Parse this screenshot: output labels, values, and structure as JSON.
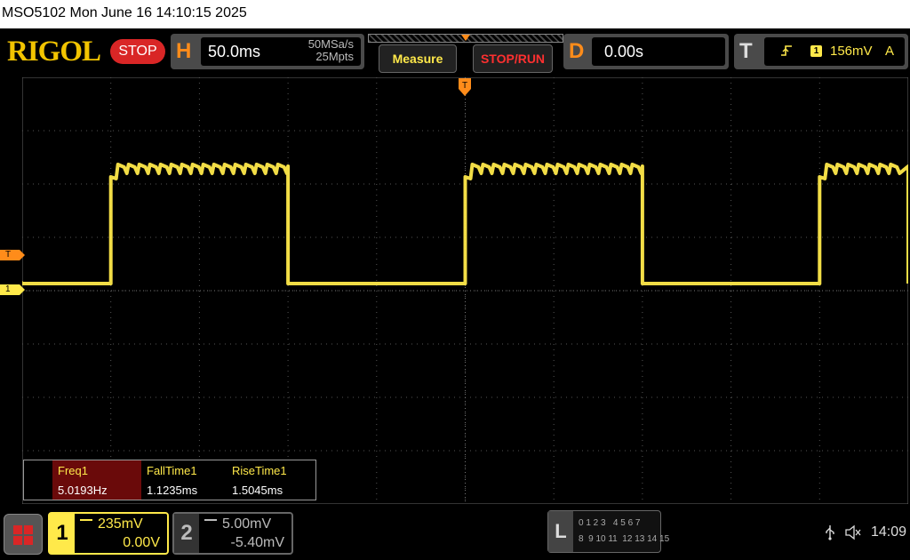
{
  "title_bar": {
    "text": "MSO5102  Mon June 16 14:10:15 2025"
  },
  "header": {
    "logo": "RIGOL",
    "run_state": "STOP",
    "horizontal": {
      "letter": "H",
      "timebase": "50.0ms",
      "sample_rate": "50MSa/s",
      "memory_depth": "25Mpts"
    },
    "buttons": {
      "measure": "Measure",
      "stop_run": "STOP/RUN"
    },
    "delay": {
      "letter": "D",
      "value": "0.00s"
    },
    "trigger": {
      "letter": "T",
      "source": "1",
      "level": "156mV",
      "mode": "A",
      "slope_icon": "rising-edge-icon"
    }
  },
  "screen": {
    "trigger_marker": "T",
    "ch1_marker": "1",
    "top_trigger_marker": "T"
  },
  "measurements": [
    {
      "name": "Freq1",
      "value": "5.0193Hz"
    },
    {
      "name": "FallTime1",
      "value": "1.1235ms"
    },
    {
      "name": "RiseTime1",
      "value": "1.5045ms"
    }
  ],
  "channels": {
    "ch1": {
      "number": "1",
      "scale": "235mV",
      "offset": "0.00V",
      "coupling_icon": "dc-coupling-icon"
    },
    "ch2": {
      "number": "2",
      "scale": "5.00mV",
      "offset": "-5.40mV",
      "coupling_icon": "dc-coupling-icon"
    }
  },
  "logic": {
    "letter": "L",
    "row1": "0 1 2 3   4 5 6 7",
    "row2": "8  9 10 11  12 13 14 15"
  },
  "status": {
    "time": "14:09"
  },
  "colors": {
    "ch1": "#ffe94a",
    "ch2": "#bbbbbb",
    "accent": "#ff8c1a",
    "stop": "#d92626",
    "grid": "#555555"
  },
  "waveform": {
    "period_ms": 200,
    "duty": 0.5,
    "high_level_div": 2.2,
    "low_level_div": 0
  }
}
